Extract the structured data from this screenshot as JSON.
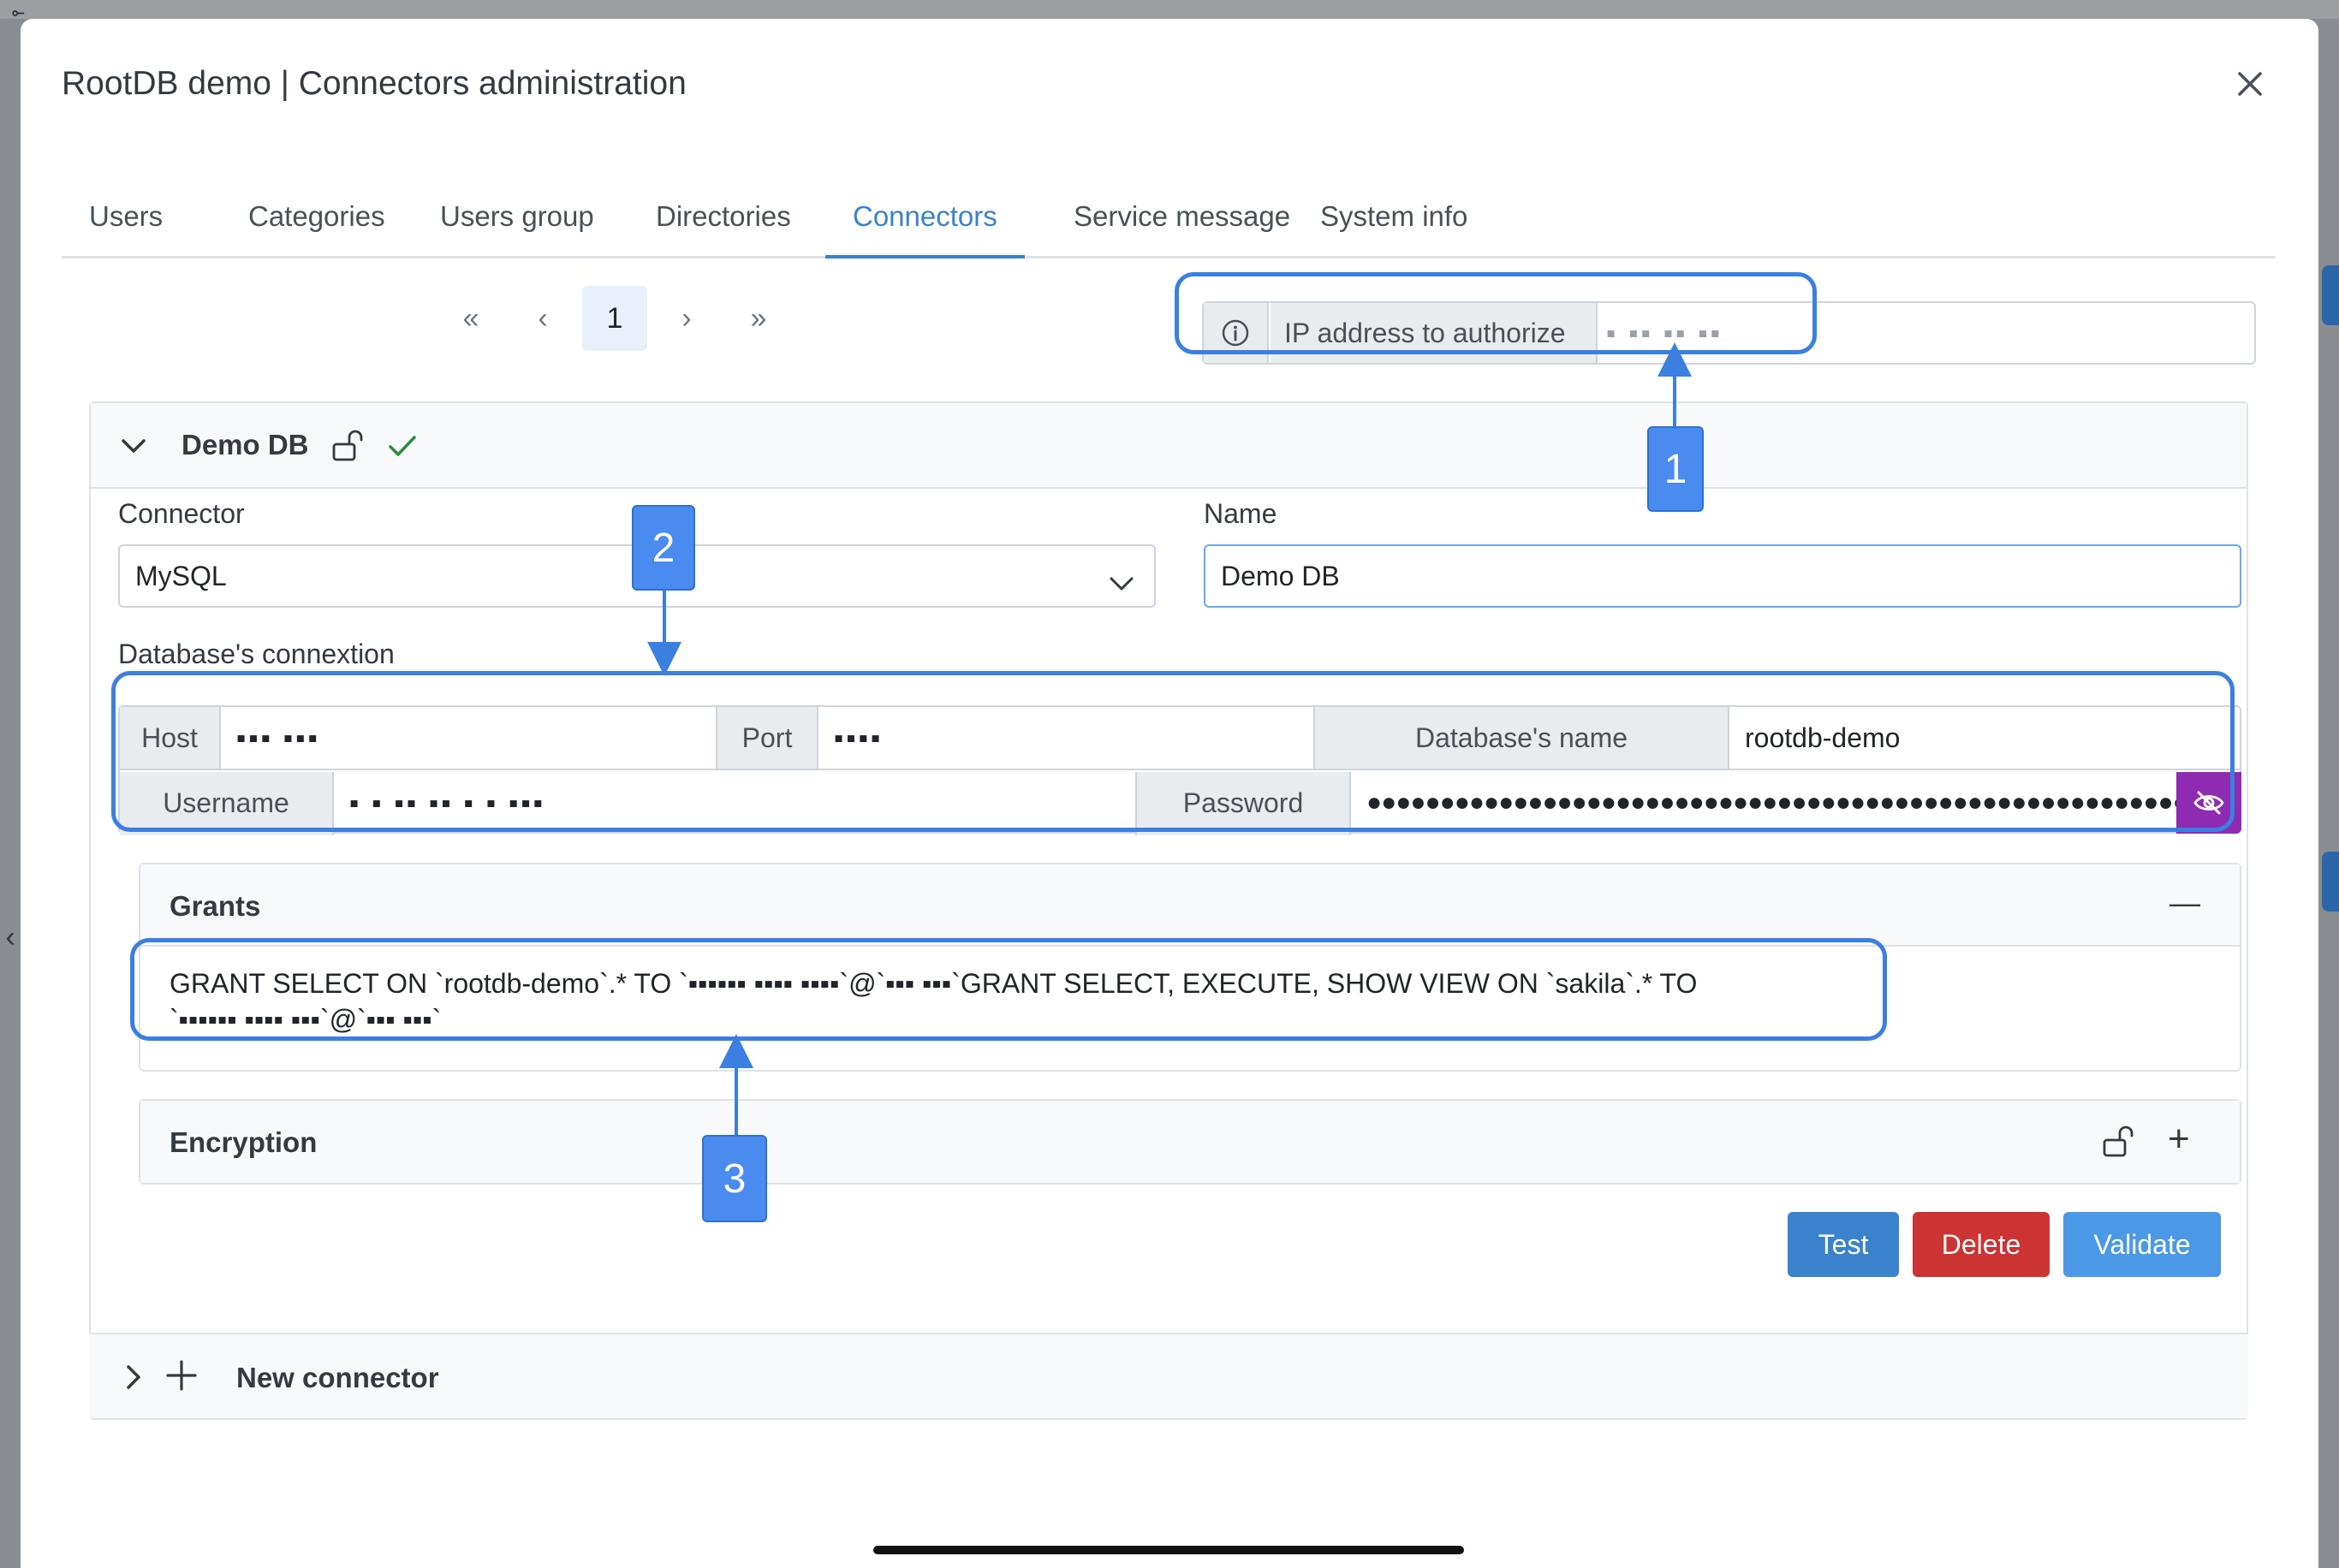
{
  "modal": {
    "title": "RootDB demo | Connectors administration"
  },
  "tabs": [
    {
      "label": "Users"
    },
    {
      "label": "Categories"
    },
    {
      "label": "Users group"
    },
    {
      "label": "Directories"
    },
    {
      "label": "Connectors",
      "active": true
    },
    {
      "label": "Service message"
    },
    {
      "label": "System info"
    }
  ],
  "pagination": {
    "first": "«",
    "prev": "‹",
    "current_page": "1",
    "next": "›",
    "last": "»"
  },
  "ip": {
    "label": "IP address to authorize",
    "value": "▪ ▪▪ ▪▪ ▪▪"
  },
  "connector_item": {
    "title": "Demo DB",
    "lock_state": "unlocked",
    "status": "connected"
  },
  "form": {
    "connector_label": "Connector",
    "connector_value": "MySQL",
    "name_label": "Name",
    "name_value": "Demo DB",
    "connexion_label": "Database's connextion",
    "host_label": "Host",
    "host_value": "▪▪▪ ▪▪▪",
    "port_label": "Port",
    "port_value": "▪▪▪▪",
    "dbname_label": "Database's name",
    "dbname_value": "rootdb-demo",
    "username_label": "Username",
    "username_value": "▪ ▪ ▪▪ ▪▪ ▪ ▪ ▪▪▪",
    "password_label": "Password",
    "password_value": "●●●●●●●●●●●●●●●●●●●●●●●●●●●●●●●●●●●●●●●●●●●●●●●●●●●●●●●●●●●●●"
  },
  "grants": {
    "title": "Grants",
    "collapse_symbol": "—",
    "text_line1": "GRANT SELECT ON `rootdb-demo`.* TO `▪▪▪▪▪▪ ▪▪▪▪ ▪▪▪▪`@`▪▪▪  ▪▪▪`GRANT SELECT, EXECUTE, SHOW VIEW ON `sakila`.* TO",
    "text_line2": "`▪▪▪▪▪▪ ▪▪▪▪ ▪▪▪`@`▪▪▪  ▪▪▪`"
  },
  "encryption": {
    "title": "Encryption",
    "expand_symbol": "+"
  },
  "buttons": {
    "test": "Test",
    "delete": "Delete",
    "validate": "Validate"
  },
  "new_connector": {
    "label": "New connector"
  },
  "callouts": {
    "one": "1",
    "two": "2",
    "three": "3"
  },
  "colors": {
    "accent": "#3b82c8",
    "highlight": "#3b7fe0",
    "test_button": "#3a83cc",
    "delete_button": "#cc3333",
    "validate_button": "#4a98e6",
    "password_toggle": "#8e2bb0",
    "check": "#2e8b3a"
  }
}
